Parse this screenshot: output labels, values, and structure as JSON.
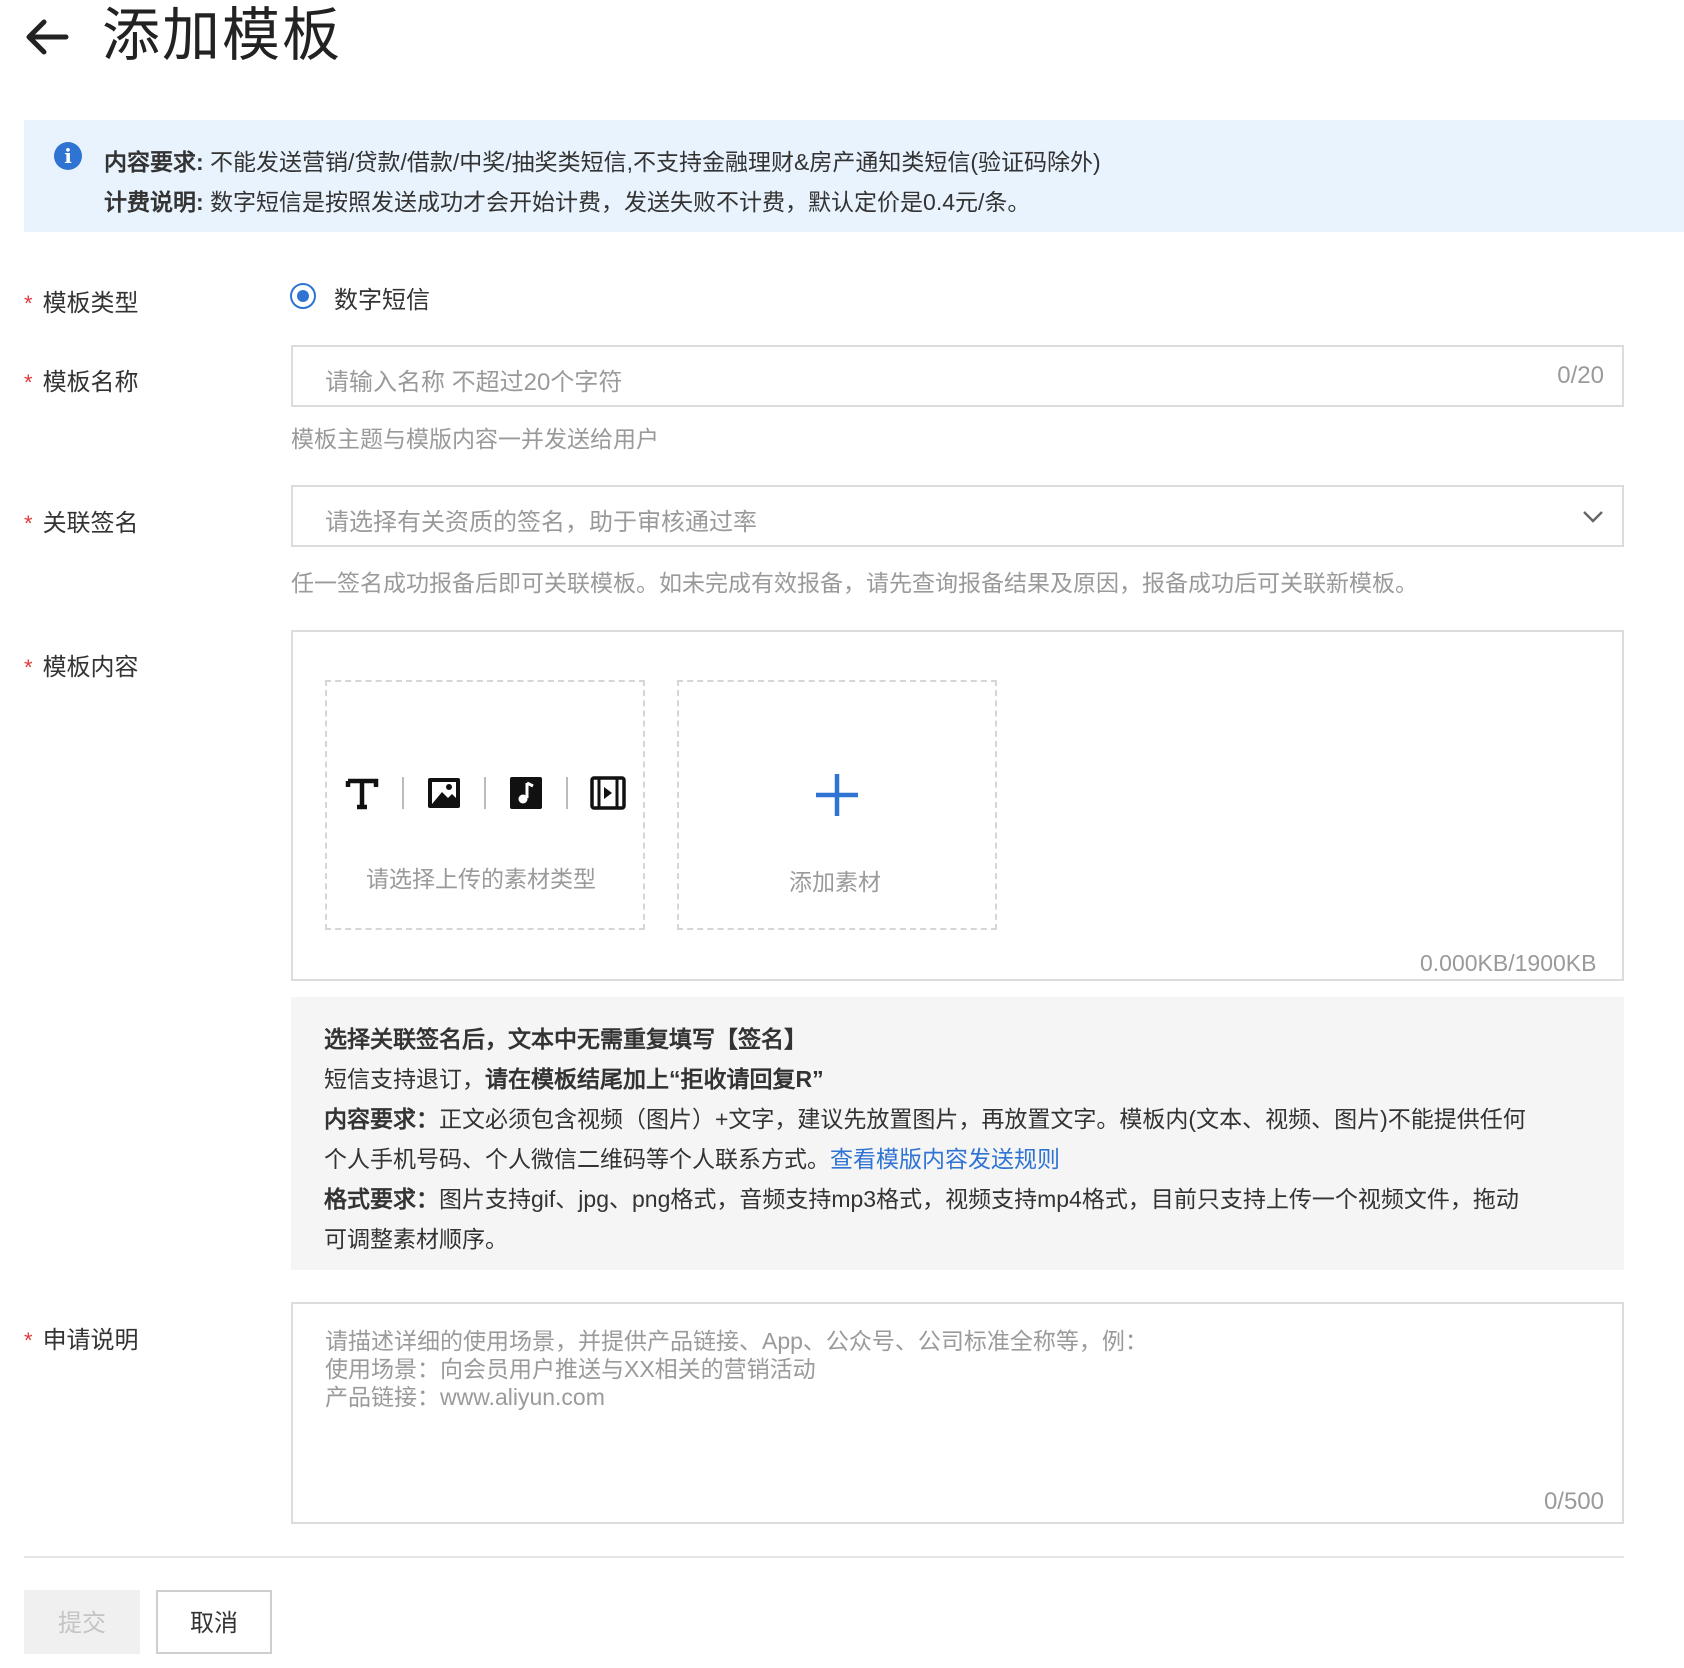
{
  "header": {
    "title": "添加模板",
    "back_icon": "arrow-left-icon"
  },
  "notice": {
    "icon": "info-icon",
    "line1_label": "内容要求:",
    "line1_text": " 不能发送营销/贷款/借款/中奖/抽奖类短信,不支持金融理财&房产通知类短信(验证码除外)",
    "line2_label": "计费说明:",
    "line2_text": " 数字短信是按照发送成功才会开始计费，发送失败不计费，默认定价是0.4元/条。"
  },
  "form": {
    "required_mark": "*",
    "template_type": {
      "label": "模板类型",
      "option": "数字短信",
      "selected": true
    },
    "template_name": {
      "label": "模板名称",
      "placeholder": "请输入名称 不超过20个字符",
      "value": "",
      "counter": "0/20",
      "hint": "模板主题与模版内容一并发送给用户"
    },
    "signature": {
      "label": "关联签名",
      "placeholder": "请选择有关资质的签名，助于审核通过率",
      "hint": "任一签名成功报备后即可关联模板。如未完成有效报备，请先查询报备结果及原因，报备成功后可关联新模板。"
    },
    "content": {
      "label": "模板内容",
      "type_picker_text": "请选择上传的素材类型",
      "type_icons": [
        "text-icon",
        "image-icon",
        "audio-icon",
        "video-icon"
      ],
      "add_text": "添加素材",
      "size_counter": "0.000KB/1900KB"
    },
    "tips": {
      "line1_bold": "选择关联签名后，文本中无需重复填写【签名】",
      "line2_prefix": "短信支持退订，",
      "line2_bold": "请在模板结尾加上“拒收请回复R”",
      "line3_label": "内容要求：",
      "line3_text": "正文必须包含视频（图片）+文字，建议先放置图片，再放置文字。模板内(文本、视频、图片)不能提供任何",
      "line4_text": "个人手机号码、个人微信二维码等个人联系方式。",
      "line4_link": "查看模版内容发送规则",
      "line5_label": "格式要求：",
      "line5_text": "图片支持gif、jpg、png格式，音频支持mp3格式，视频支持mp4格式，目前只支持上传一个视频文件，拖动",
      "line6_text": "可调整素材顺序。"
    },
    "description": {
      "label": "申请说明",
      "placeholder_lines": [
        "请描述详细的使用场景，并提供产品链接、App、公众号、公司标准全称等，例：",
        "使用场景：向会员用户推送与XX相关的营销活动",
        "产品链接：www.aliyun.com"
      ],
      "counter": "0/500"
    }
  },
  "actions": {
    "submit": "提交",
    "cancel": "取消"
  },
  "colors": {
    "accent": "#2f74d3",
    "required": "#e4393c",
    "notice_bg": "#e9f3fd"
  }
}
